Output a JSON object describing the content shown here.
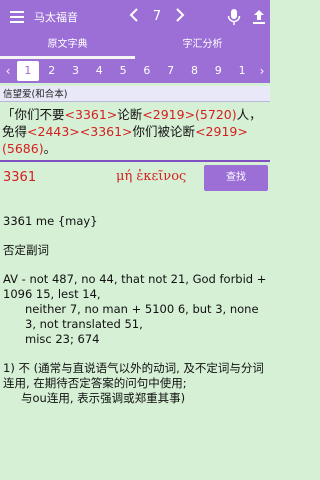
{
  "header": {
    "title": "马太福音",
    "prev_icon": "chevron-left-icon",
    "chapter": "7",
    "next_icon": "chevron-right-icon",
    "mic_icon": "microphone-icon",
    "upload_icon": "upload-icon"
  },
  "tabs": [
    {
      "label": "原文字典",
      "active": true
    },
    {
      "label": "字汇分析",
      "active": false
    }
  ],
  "verses": {
    "prev": "‹",
    "next": "›",
    "numbers": [
      "1",
      "2",
      "3",
      "4",
      "5",
      "6",
      "7",
      "8",
      "9",
      "1"
    ],
    "active_index": 0
  },
  "version_label": "信望爱(和合本)",
  "verse": {
    "t1": "「你们不要",
    "c1": "<3361>",
    "t2": "论断",
    "c2": "<2919>(5720)",
    "t3": "人，免得",
    "c3": "<2443><3361>",
    "t4": "你们被论断",
    "c4": "<2919>(5686)",
    "t5": "。"
  },
  "search": {
    "strong_number": "3361",
    "greek": "μή ἐκεῖνος",
    "button_label": "查找"
  },
  "entry": {
    "line1": "3361 me {may}",
    "line2": "否定副词",
    "av_a": "AV - not 487, no 44, that not 21, God forbid + 1096 15, lest 14,",
    "av_b": "neither 7, no man + 5100 6, but 3, none 3, not translated 51,",
    "av_c": "misc 23; 674",
    "def1": "1) 不 (通常与直说语气以外的动词, 及不定词与分词连用, 在期待否定答案的问句中使用;",
    "def2": "与ou连用, 表示强调或郑重其事)"
  },
  "colors": {
    "accent": "#9c6fd6",
    "background": "#d6f0d6",
    "strong_red": "#d42020"
  }
}
